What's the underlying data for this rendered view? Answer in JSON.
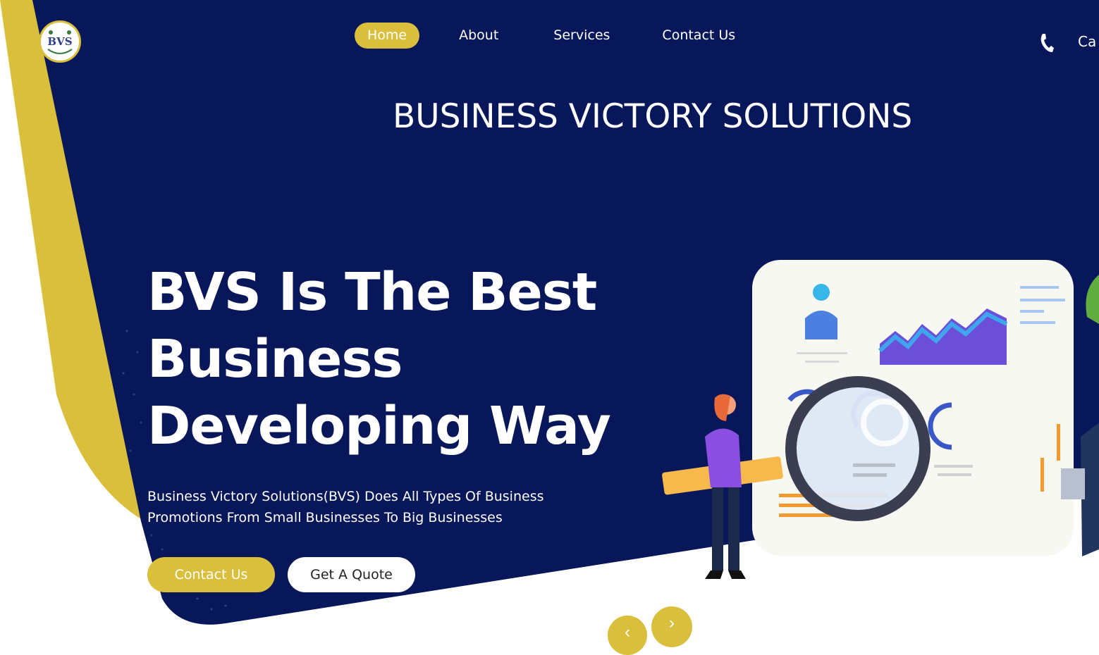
{
  "brand": {
    "logo_text": "BVS",
    "name": "BUSINESS VICTORY SOLUTIONS"
  },
  "nav": [
    {
      "label": "Home",
      "active": true
    },
    {
      "label": "About",
      "active": false
    },
    {
      "label": "Services",
      "active": false
    },
    {
      "label": "Contact Us",
      "active": false
    }
  ],
  "header": {
    "call_label": "Ca",
    "phone_icon": "phone-icon"
  },
  "hero": {
    "title_line1": "BVS Is The Best",
    "title_line2": "Business",
    "title_line3": "Developing Way",
    "subtitle_line1": "Business Victory Solutions(BVS) Does All Types Of Business",
    "subtitle_line2": "Promotions From Small Businesses To Big Businesses",
    "contact_button": "Contact Us",
    "quote_button": "Get A Quote"
  },
  "slider": {
    "prev_icon": "chevron-left-icon",
    "next_icon": "chevron-right-icon"
  },
  "colors": {
    "navy": "#07175a",
    "gold": "#d9bf3b",
    "white": "#ffffff"
  }
}
